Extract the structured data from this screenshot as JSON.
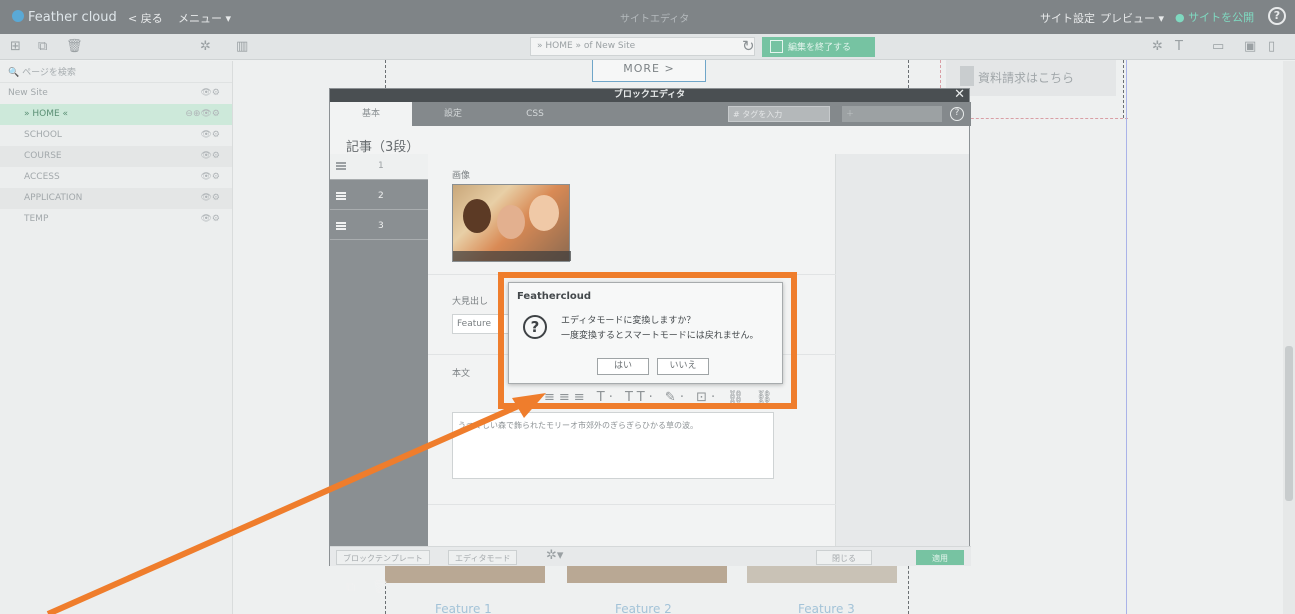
{
  "topbar": {
    "logo": "Feather cloud",
    "back": "< 戻る",
    "menu": "メニュー ▾",
    "center_title": "サイトエディタ",
    "site_settings": "サイト設定",
    "preview": "プレビュー ▾",
    "publish": "サイトを公開",
    "help": "?"
  },
  "toolbar2": {
    "url": "» HOME » of New Site",
    "finish_editing": "編集を終了する"
  },
  "sidebar": {
    "search_placeholder": "ページを検索",
    "items": [
      {
        "label": "New Site"
      },
      {
        "label": "» HOME «"
      },
      {
        "label": "SCHOOL"
      },
      {
        "label": "COURSE"
      },
      {
        "label": "ACCESS"
      },
      {
        "label": "APPLICATION"
      },
      {
        "label": "TEMP"
      }
    ]
  },
  "canvas": {
    "more_button": "MORE  >",
    "request_docs": "資料請求はこちら",
    "features": [
      "Feature 1",
      "Feature 2",
      "Feature 3"
    ]
  },
  "modal": {
    "title": "ブロックエディタ",
    "tabs": [
      "基本",
      "設定",
      "CSS"
    ],
    "tag_placeholder": "# タグを入力",
    "block_title": "記事（3段）",
    "blocks": [
      "1",
      "2",
      "3"
    ],
    "image_label": "画像",
    "heading_label": "大見出し",
    "heading_value": "Feature",
    "body_label": "本文",
    "body_text": "うつくしい森で飾られたモリーオ市郊外のぎらぎらひかる草の波。",
    "footer": {
      "block_template": "ブロックテンプレート",
      "editor_mode": "エディタモード",
      "close": "閉じる",
      "apply": "適用"
    }
  },
  "dialog": {
    "title": "Feathercloud",
    "message_line1": "エディタモードに変換しますか？",
    "message_line2": "一度変換するとスマートモードには戻れません。",
    "yes": "はい",
    "no": "いいえ"
  },
  "colors": {
    "highlight": "#ef7d2c",
    "accent_green": "#77c3a2",
    "topbar": "#7f8487"
  }
}
